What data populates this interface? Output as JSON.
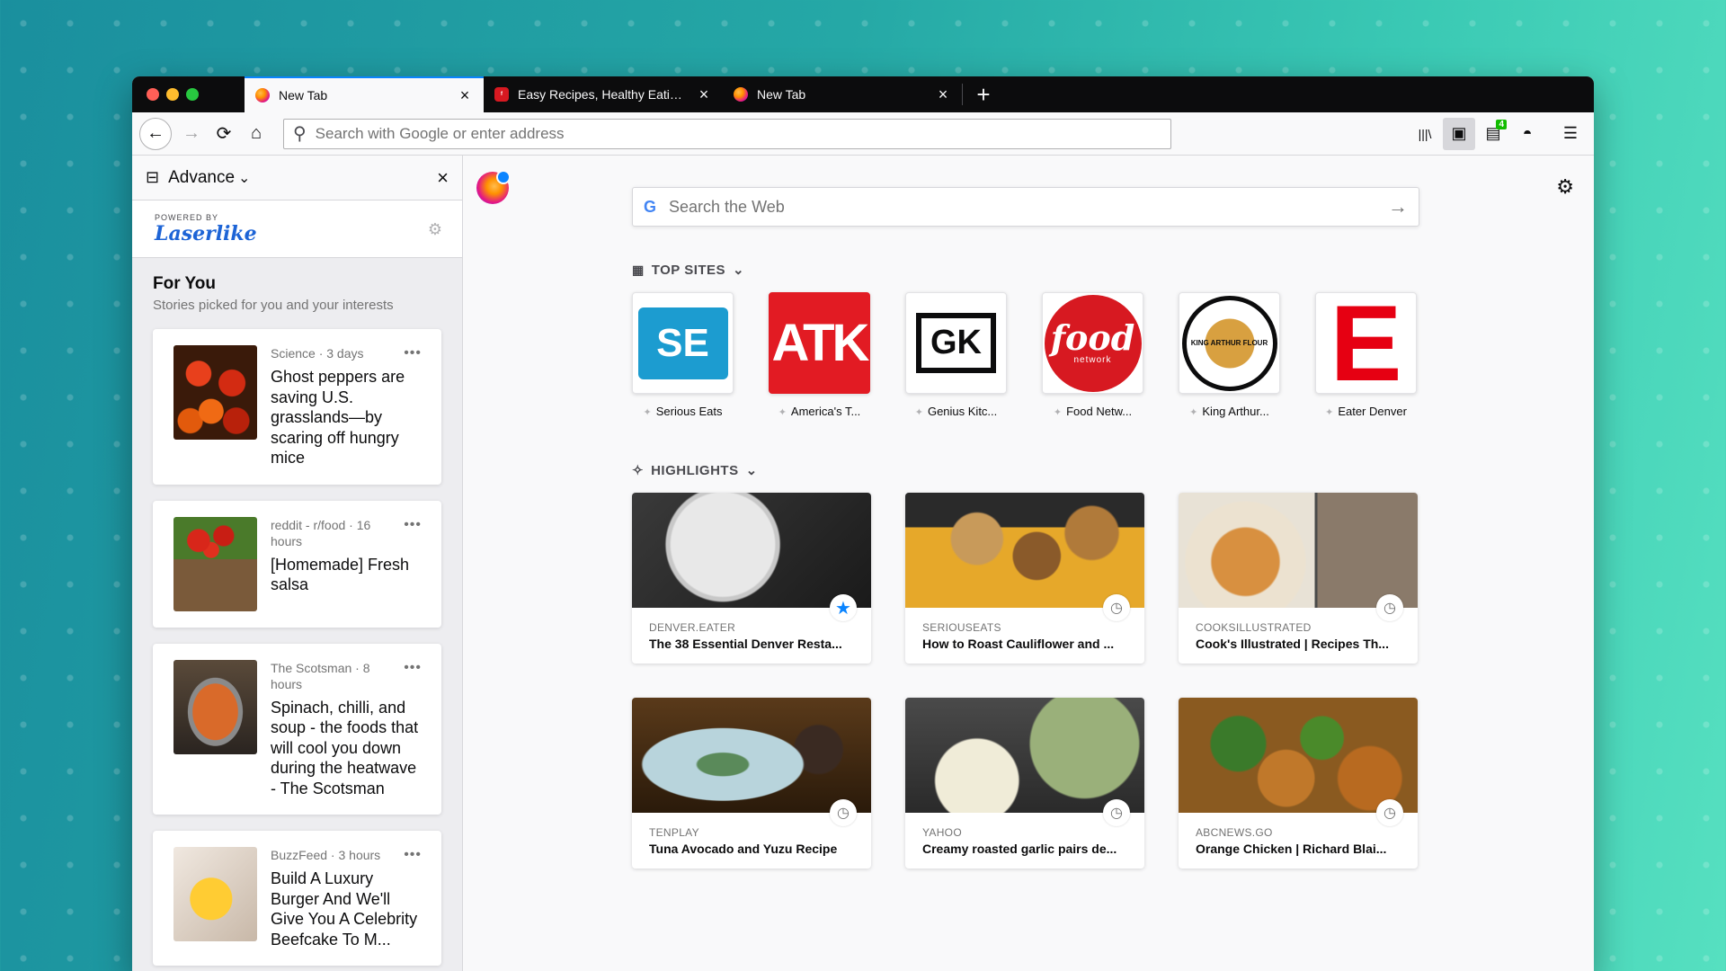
{
  "tabs": [
    {
      "label": "New Tab",
      "active": true
    },
    {
      "label": "Easy Recipes, Healthy Eating Ideas and Chef Recipe Videos | Food Network",
      "active": false
    },
    {
      "label": "New Tab",
      "active": false
    }
  ],
  "icons": {
    "close": "×",
    "new_tab": "+",
    "back": "←",
    "forward": "→",
    "reload": "⟳",
    "home": "⌂",
    "search": "⚲",
    "library": "|||\\",
    "sidebar": "▣",
    "synced_tabs": "▤",
    "pocket": "◓",
    "menu": "☰",
    "chevron": "⌄",
    "gear": "⚙",
    "more": "•••",
    "pin": "✦",
    "clock": "◷",
    "bookmark_star": "★",
    "arrow": "→"
  },
  "nav": {
    "url_placeholder": "Search with Google or enter address",
    "badge_count": "4"
  },
  "sidebar": {
    "title": "Advance",
    "powered_by": "POWERED BY",
    "brand": "Laserlike",
    "for_you_title": "For You",
    "for_you_subtitle": "Stories picked for you and your interests",
    "stories": [
      {
        "meta": "Science · 3 days",
        "title": "Ghost peppers are saving U.S. grasslands—by scaring off hungry mice",
        "image": "peppers"
      },
      {
        "meta": "reddit - r/food · 16 hours",
        "title": "[Homemade] Fresh salsa",
        "image": "salsa"
      },
      {
        "meta": "The Scotsman · 8 hours",
        "title": "Spinach, chilli, and soup - the foods that will cool you down during the heatwave - The Scotsman",
        "image": "soup"
      },
      {
        "meta": "BuzzFeed · 3 hours",
        "title": "Build A Luxury Burger And We'll Give You A Celebrity Beefcake To M...",
        "image": "emoji"
      }
    ]
  },
  "newtab": {
    "search_placeholder": "Search the Web",
    "google_letter": "G",
    "top_sites_label": "TOP SITES",
    "highlights_label": "HIGHLIGHTS",
    "top_sites": [
      {
        "label": "Serious Eats",
        "tile_text": "SE",
        "bg": "#1c9cd0",
        "fg": "#ffffff"
      },
      {
        "label": "America's T...",
        "tile_text": "ATK",
        "bg": "#e21b23",
        "fg": "#ffffff"
      },
      {
        "label": "Genius Kitc...",
        "tile_text": "GK",
        "bg": "#ffffff",
        "fg": "#0c0c0d"
      },
      {
        "label": "Food Netw...",
        "tile_text": "food",
        "bg": "#d71921",
        "fg": "#ffffff"
      },
      {
        "label": "King Arthur...",
        "tile_text": "KING ARTHUR FLOUR",
        "bg": "#ffffff",
        "fg": "#0c0c0d"
      },
      {
        "label": "Eater Denver",
        "tile_text": "E",
        "bg": "#ffffff",
        "fg": "#e60012"
      }
    ],
    "highlights": [
      {
        "source": "DENVER.EATER",
        "title": "The 38 Essential Denver Resta...",
        "type": "bookmark",
        "image": "plate-dark"
      },
      {
        "source": "SERIOUSEATS",
        "title": "How to Roast Cauliflower and ...",
        "type": "history",
        "image": "cauliflower"
      },
      {
        "source": "COOKSILLUSTRATED",
        "title": "Cook's Illustrated | Recipes Th...",
        "type": "history",
        "image": "chicken"
      },
      {
        "source": "TENPLAY",
        "title": "Tuna Avocado and Yuzu Recipe",
        "type": "history",
        "image": "tuna"
      },
      {
        "source": "YAHOO",
        "title": "Creamy roasted garlic pairs de...",
        "type": "history",
        "image": "pasta"
      },
      {
        "source": "ABCNEWS.GO",
        "title": "Orange Chicken | Richard Blai...",
        "type": "history",
        "image": "orange-chicken"
      }
    ]
  }
}
